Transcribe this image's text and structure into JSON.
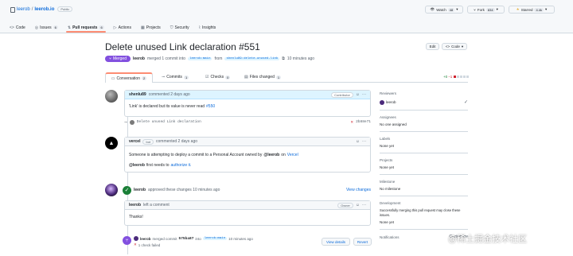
{
  "repo": {
    "owner": "leerob",
    "sep": "/",
    "name": "leerob.io",
    "visibility": "Public",
    "watch_label": "Watch",
    "watch_count": "48",
    "fork_label": "Fork",
    "fork_count": "834",
    "star_label": "Starred",
    "star_count": "4.4k"
  },
  "tabs": [
    {
      "label": "Code",
      "icon": "code-icon"
    },
    {
      "label": "Issues",
      "count": "6",
      "icon": "issue-icon"
    },
    {
      "label": "Pull requests",
      "count": "6",
      "icon": "pull-request-icon"
    },
    {
      "label": "Actions",
      "icon": "actions-icon"
    },
    {
      "label": "Projects",
      "icon": "projects-icon"
    },
    {
      "label": "Security",
      "icon": "shield-icon"
    },
    {
      "label": "Insights",
      "icon": "graph-icon"
    }
  ],
  "pr": {
    "title": "Delete unused Link declaration #551",
    "edit_label": "Edit",
    "code_label": "Code",
    "state": "Merged",
    "author": "leerob",
    "meta_text": "merged 1 commit into",
    "base_branch": "leerob:main",
    "from_text": "from",
    "head_branch": "shenlu89:delete-unused-link",
    "time_text": "10 minutes ago"
  },
  "pr_tabs": [
    {
      "label": "Conversation",
      "count": "2"
    },
    {
      "label": "Commits",
      "count": "1"
    },
    {
      "label": "Checks",
      "count": "0"
    },
    {
      "label": "Files changed",
      "count": "1"
    }
  ],
  "diffstat": {
    "add": "+0",
    "del": "−1"
  },
  "timeline": {
    "comment1": {
      "author": "shenlu89",
      "meta": "commented 2 days ago",
      "badge": "Contributor",
      "body_text": "'Link' is declared but its value is never read",
      "body_link": "#550"
    },
    "commit": {
      "message": "Delete unused Link declaration",
      "sha": "2b88e71"
    },
    "comment2": {
      "author": "vercel",
      "bot_badge": "bot",
      "meta": "commented 2 days ago",
      "line1_pre": "Someone is attempting to deploy a commit to a Personal Account owned by",
      "line1_user": "@leerob",
      "line1_mid": "on",
      "line1_link": "Vercel",
      "line2_user": "@leerob",
      "line2_mid": "first needs to",
      "line2_link": "authorize it."
    },
    "approval": {
      "author": "leerob",
      "text": "approved these changes 10 minutes ago",
      "action": "View changes"
    },
    "comment3": {
      "author": "leerob",
      "meta": "left a comment",
      "badge": "Owner",
      "body": "Thanks!"
    },
    "merge": {
      "author": "leerob",
      "text1": "merged commit",
      "sha": "575ba87",
      "text2": "into",
      "branch": "leerob:main",
      "time": "10 minutes ago",
      "sub": "1 check failed",
      "view_details": "View details",
      "revert": "Revert"
    }
  },
  "sidebar": {
    "reviewers_title": "Reviewers",
    "reviewer": "leerob",
    "assignees_title": "Assignees",
    "assignees_val": "No one assigned",
    "labels_title": "Labels",
    "labels_val": "None yet",
    "projects_title": "Projects",
    "projects_val": "None yet",
    "milestone_title": "Milestone",
    "milestone_val": "No milestone",
    "development_title": "Development",
    "development_val": "Successfully merging this pull request may close these issues.",
    "development_none": "None yet",
    "notifications_title": "Notifications",
    "notifications_action": "Customize"
  },
  "watermark": "@稀土掘金技术社区",
  "colors": {
    "accent": "#0969da",
    "merged": "#8250df",
    "success": "#1a7f37",
    "danger": "#cf222e",
    "active_tab": "#fd8c73"
  }
}
